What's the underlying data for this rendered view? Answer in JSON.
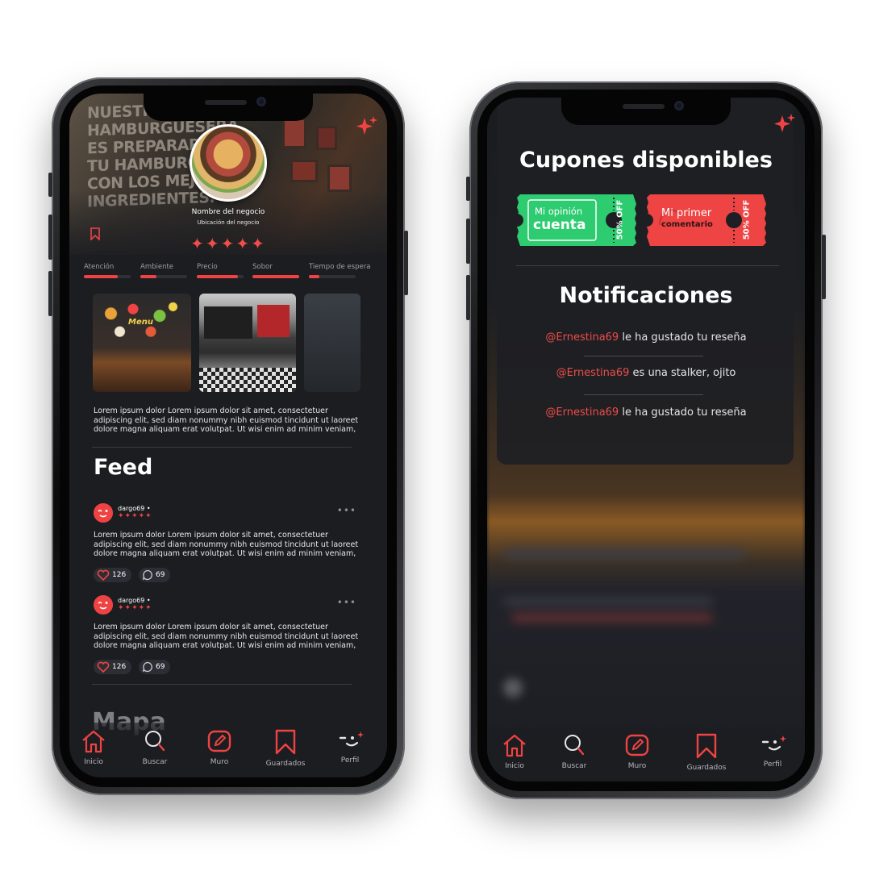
{
  "phone1": {
    "hero_text": "NUESTRA CULTO\nHAMBURGUESERA\nES PREPARAR\nTU HAMBURGUESA\nCON LOS MEJORES\nINGREDIENTES.",
    "business_name": "Nombre del negocio",
    "business_location": "Ubicación del negocio",
    "stars": "✦✦✦✦✦",
    "ratings": [
      {
        "label": "Atención",
        "value": 0.72
      },
      {
        "label": "Ambiente",
        "value": 0.35
      },
      {
        "label": "Precio",
        "value": 0.88
      },
      {
        "label": "Sobor",
        "value": 1.0
      },
      {
        "label": "Tiempo de espera",
        "value": 0.22
      }
    ],
    "gallery_menu_word": "Menu",
    "description": "Lorem ipsum dolor Lorem ipsum dolor sit amet, consectetuer adipiscing elit, sed diam nonummy nibh euismod tincidunt ut laoreet dolore magna aliquam erat volutpat. Ut wisi enim ad minim veniam,",
    "feed_title": "Feed",
    "posts": [
      {
        "user": "dargo69 •",
        "stars": "✦✦✦✦✦",
        "text": "Lorem ipsum dolor Lorem ipsum dolor sit amet, consectetuer adipiscing elit, sed diam nonummy nibh euismod tincidunt ut laoreet dolore magna aliquam erat volutpat. Ut wisi enim ad minim veniam,",
        "likes": "126",
        "comments": "69"
      },
      {
        "user": "dargo69 •",
        "stars": "✦✦✦✦✦",
        "text": "Lorem ipsum dolor Lorem ipsum dolor sit amet, consectetuer adipiscing elit, sed diam nonummy nibh euismod tincidunt ut laoreet dolore magna aliquam erat volutpat. Ut wisi enim ad minim veniam,",
        "likes": "126",
        "comments": "69"
      }
    ],
    "more_glyph": "•••",
    "map_title": "Mapa"
  },
  "phone2": {
    "coupons_title": "Cupones disponibles",
    "coupons": [
      {
        "line1": "Mi opinión",
        "line2": "cuenta",
        "discount": "50% OFF",
        "color": "#2ecc71"
      },
      {
        "line1": "Mi primer",
        "line2": "comentario",
        "discount": "50% OFF",
        "color": "#ef4444"
      }
    ],
    "notifications_title": "Notificaciones",
    "notifications": [
      {
        "user": "@Ernestina69",
        "text": " le ha gustado tu reseña"
      },
      {
        "user": "@Ernestina69",
        "text": " es una stalker, ojito"
      },
      {
        "user": "@Ernestina69",
        "text": " le ha gustado tu reseña"
      }
    ]
  },
  "tabbar": {
    "items": [
      {
        "label": "Inicio",
        "icon": "home-icon"
      },
      {
        "label": "Buscar",
        "icon": "search-icon"
      },
      {
        "label": "Muro",
        "icon": "edit-icon"
      },
      {
        "label": "Guardados",
        "icon": "bookmark-icon"
      },
      {
        "label": "Perfil",
        "icon": "wink-face-icon"
      }
    ]
  },
  "colors": {
    "accent": "#ef4343",
    "background": "#1c1d21",
    "coupon_green": "#2ecc71",
    "coupon_red": "#ef4444"
  }
}
